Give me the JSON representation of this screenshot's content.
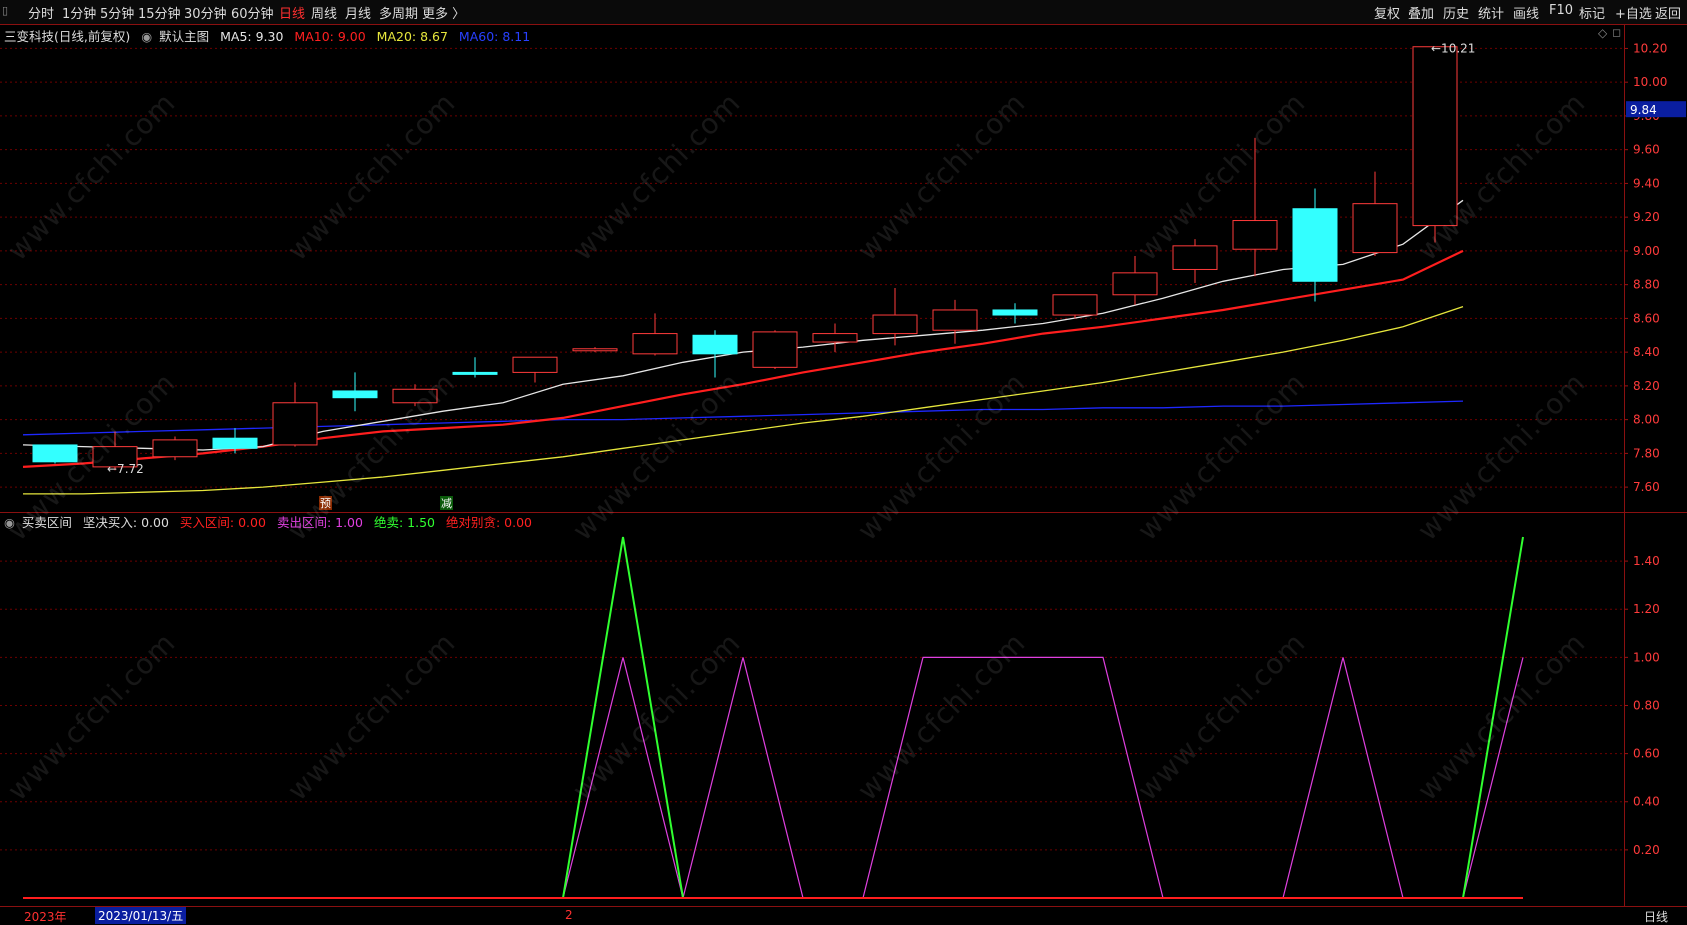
{
  "toolbar": {
    "periods": [
      "分时",
      "1分钟",
      "5分钟",
      "15分钟",
      "30分钟",
      "60分钟",
      "日线",
      "周线",
      "月线",
      "多周期",
      "更多 〉"
    ],
    "active_period": "日线",
    "right_items": [
      "复权",
      "叠加",
      "历史",
      "统计",
      "画线",
      "F10",
      "标记",
      "+自选",
      "返回"
    ]
  },
  "main_header": {
    "stock": "三变科技(日线,前复权)",
    "template": "默认主图",
    "ma5": "MA5: 9.30",
    "ma10": "MA10: 9.00",
    "ma20": "MA20: 8.67",
    "ma60": "MA60: 8.11"
  },
  "sub_header": {
    "name": "买卖区间",
    "firm_buy": "坚决买入: 0.00",
    "buy_zone": "买入区间: 0.00",
    "sell_zone": "卖出区间: 1.00",
    "sell_all": "绝卖: 1.50",
    "absolute_sell": "绝对别贪: 0.00"
  },
  "colors": {
    "up": "#ff3b3b",
    "down": "#33ffff",
    "ma5": "#e6e6e6",
    "ma10": "#ff1e1e",
    "ma20": "#e6e63c",
    "ma60": "#1e28ff",
    "sell_zone": "#e040e0",
    "sell_all": "#30ff30",
    "grid": "#6e0000"
  },
  "chart_data": [
    {
      "type": "candlestick",
      "y_range": [
        7.5,
        10.25
      ],
      "y_ticks": [
        "10.20",
        "10.00",
        "9.80",
        "9.60",
        "9.40",
        "9.20",
        "9.00",
        "8.80",
        "8.60",
        "8.40",
        "8.20",
        "8.00",
        "7.80",
        "7.60"
      ],
      "candles": [
        {
          "o": 7.85,
          "c": 7.75,
          "h": 7.85,
          "l": 7.74
        },
        {
          "o": 7.72,
          "c": 7.84,
          "h": 7.93,
          "l": 7.7
        },
        {
          "o": 7.78,
          "c": 7.88,
          "h": 7.9,
          "l": 7.76
        },
        {
          "o": 7.89,
          "c": 7.83,
          "h": 7.95,
          "l": 7.8
        },
        {
          "o": 7.85,
          "c": 8.1,
          "h": 8.22,
          "l": 7.84
        },
        {
          "o": 8.17,
          "c": 8.13,
          "h": 8.28,
          "l": 8.05
        },
        {
          "o": 8.1,
          "c": 8.18,
          "h": 8.21,
          "l": 8.08
        },
        {
          "o": 8.28,
          "c": 8.27,
          "h": 8.37,
          "l": 8.25
        },
        {
          "o": 8.28,
          "c": 8.37,
          "h": 8.37,
          "l": 8.22
        },
        {
          "o": 8.41,
          "c": 8.42,
          "h": 8.43,
          "l": 8.4
        },
        {
          "o": 8.39,
          "c": 8.51,
          "h": 8.63,
          "l": 8.38
        },
        {
          "o": 8.5,
          "c": 8.39,
          "h": 8.53,
          "l": 8.25
        },
        {
          "o": 8.31,
          "c": 8.52,
          "h": 8.53,
          "l": 8.3
        },
        {
          "o": 8.46,
          "c": 8.51,
          "h": 8.57,
          "l": 8.4
        },
        {
          "o": 8.51,
          "c": 8.62,
          "h": 8.78,
          "l": 8.44
        },
        {
          "o": 8.53,
          "c": 8.65,
          "h": 8.71,
          "l": 8.45
        },
        {
          "o": 8.65,
          "c": 8.62,
          "h": 8.69,
          "l": 8.57
        },
        {
          "o": 8.62,
          "c": 8.74,
          "h": 8.74,
          "l": 8.6
        },
        {
          "o": 8.74,
          "c": 8.87,
          "h": 8.97,
          "l": 8.68
        },
        {
          "o": 8.89,
          "c": 9.03,
          "h": 9.07,
          "l": 8.81
        },
        {
          "o": 9.01,
          "c": 9.18,
          "h": 9.67,
          "l": 8.85
        },
        {
          "o": 9.25,
          "c": 8.82,
          "h": 9.37,
          "l": 8.7
        },
        {
          "o": 8.99,
          "c": 9.28,
          "h": 9.47,
          "l": 8.97
        },
        {
          "o": 9.15,
          "c": 10.21,
          "h": 10.21,
          "l": 9.05
        }
      ],
      "ma5": [
        7.85,
        7.84,
        7.83,
        7.82,
        7.84,
        7.93,
        7.99,
        8.05,
        8.1,
        8.21,
        8.26,
        8.34,
        8.4,
        8.43,
        8.47,
        8.5,
        8.53,
        8.57,
        8.63,
        8.72,
        8.82,
        8.89,
        8.92,
        9.04,
        9.3
      ],
      "ma10": [
        7.72,
        7.74,
        7.77,
        7.8,
        7.84,
        7.89,
        7.93,
        7.95,
        7.97,
        8.01,
        8.08,
        8.15,
        8.21,
        8.28,
        8.34,
        8.4,
        8.45,
        8.51,
        8.55,
        8.6,
        8.65,
        8.71,
        8.77,
        8.83,
        9.0
      ],
      "ma20": [
        7.56,
        7.56,
        7.57,
        7.58,
        7.6,
        7.63,
        7.66,
        7.7,
        7.74,
        7.78,
        7.83,
        7.88,
        7.93,
        7.98,
        8.02,
        8.07,
        8.12,
        8.17,
        8.22,
        8.28,
        8.34,
        8.4,
        8.47,
        8.55,
        8.67
      ],
      "ma60": [
        7.91,
        7.92,
        7.93,
        7.94,
        7.95,
        7.96,
        7.97,
        7.98,
        7.99,
        8.0,
        8.0,
        8.01,
        8.02,
        8.03,
        8.04,
        8.05,
        8.06,
        8.06,
        8.07,
        8.07,
        8.08,
        8.08,
        8.09,
        8.1,
        8.11
      ],
      "low_label": "7.72",
      "high_label": "10.21",
      "current_price": "9.84",
      "marker_yu": "预",
      "marker_jian": "减"
    },
    {
      "type": "line",
      "y_range": [
        0,
        1.55
      ],
      "y_ticks": [
        "1.40",
        "1.20",
        "1.00",
        "0.80",
        "0.60",
        "0.40",
        "0.20"
      ],
      "series": [
        {
          "name": "卖出区间",
          "values": [
            0,
            0,
            0,
            0,
            0,
            0,
            0,
            0,
            0,
            0,
            1,
            0,
            1,
            0,
            0,
            1,
            1,
            1,
            1,
            0,
            0,
            0,
            1,
            0,
            0,
            1
          ]
        },
        {
          "name": "绝卖",
          "values": [
            0,
            0,
            0,
            0,
            0,
            0,
            0,
            0,
            0,
            0,
            1.5,
            0,
            0,
            0,
            0,
            0,
            0,
            0,
            0,
            0,
            0,
            0,
            0,
            0,
            0,
            1.5
          ]
        },
        {
          "name": "坚决买入",
          "values": [
            0,
            0,
            0,
            0,
            0,
            0,
            0,
            0,
            0,
            0,
            0,
            0,
            0,
            0,
            0,
            0,
            0,
            0,
            0,
            0,
            0,
            0,
            0,
            0,
            0,
            0
          ]
        }
      ]
    }
  ],
  "bottom_bar": {
    "year": "2023年",
    "date": "2023/01/13/五",
    "mid": "2",
    "period": "日线"
  },
  "watermark": "www.cfchi.com"
}
